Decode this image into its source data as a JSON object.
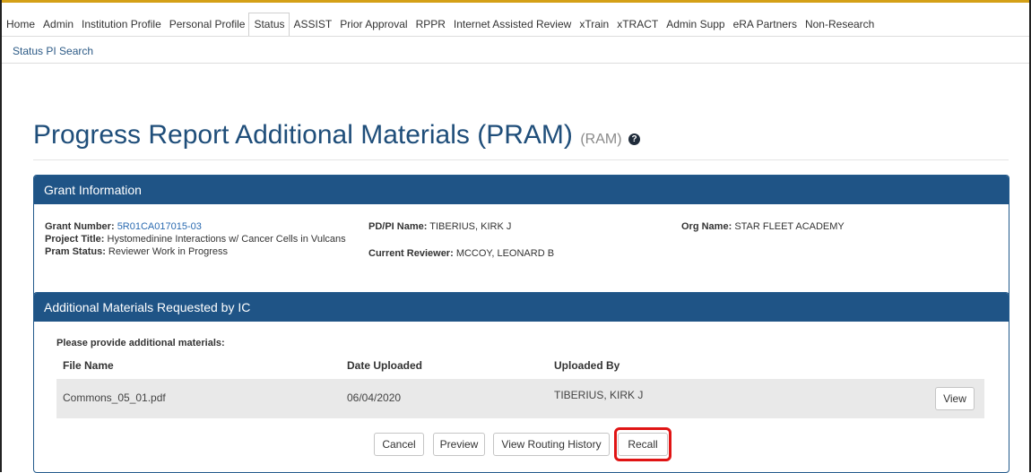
{
  "nav": {
    "tabs": [
      {
        "label": "Home"
      },
      {
        "label": "Admin"
      },
      {
        "label": "Institution Profile"
      },
      {
        "label": "Personal Profile"
      },
      {
        "label": "Status",
        "active": true
      },
      {
        "label": "ASSIST"
      },
      {
        "label": "Prior Approval"
      },
      {
        "label": "RPPR"
      },
      {
        "label": "Internet Assisted Review"
      },
      {
        "label": "xTrain"
      },
      {
        "label": "xTRACT"
      },
      {
        "label": "Admin Supp"
      },
      {
        "label": "eRA Partners"
      },
      {
        "label": "Non-Research"
      }
    ],
    "subnav": {
      "label": "Status PI Search"
    }
  },
  "page": {
    "title": "Progress Report Additional Materials (PRAM)",
    "title_suffix": "(RAM)",
    "help_icon": "question-circle-icon"
  },
  "grant_panel": {
    "heading": "Grant Information",
    "grant_number_label": "Grant Number:",
    "grant_number": "5R01CA017015-03",
    "pdpi_label": "PD/PI Name:",
    "pdpi": "TIBERIUS, KIRK J",
    "org_label": "Org Name:",
    "org": "STAR FLEET ACADEMY",
    "project_title_label": "Project Title:",
    "project_title": "Hystomedinine Interactions w/ Cancer Cells in Vulcans",
    "pram_status_label": "Pram Status:",
    "pram_status": "Reviewer Work in Progress",
    "current_reviewer_label": "Current Reviewer:",
    "current_reviewer": "MCCOY, LEONARD B"
  },
  "materials_panel": {
    "heading": "Additional Materials Requested by IC",
    "prompt": "Please provide additional materials:",
    "columns": {
      "file_name": "File Name",
      "date_uploaded": "Date Uploaded",
      "uploaded_by": "Uploaded By"
    },
    "files": [
      {
        "file_name": "Commons_05_01.pdf",
        "date_uploaded": "06/04/2020",
        "uploaded_by": "TIBERIUS, KIRK J",
        "action": "View"
      }
    ]
  },
  "actions": {
    "cancel": "Cancel",
    "preview": "Preview",
    "view_routing_history": "View Routing History",
    "recall": "Recall"
  },
  "colors": {
    "panel_header": "#1f5486",
    "title": "#1f4e7a",
    "link": "#2a6ab0",
    "highlight": "#e01414"
  }
}
